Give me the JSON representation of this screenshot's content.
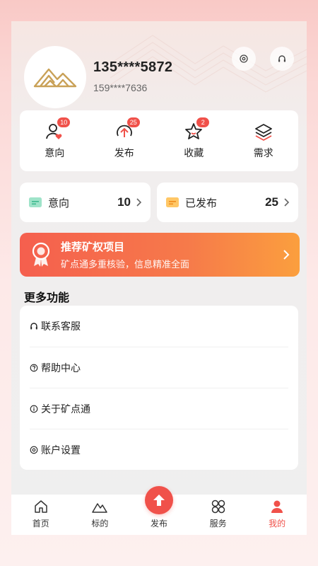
{
  "profile": {
    "name": "135****5872",
    "sub": "159****7636"
  },
  "stats": [
    {
      "label": "意向",
      "badge": "10",
      "icon": "user-heart-icon"
    },
    {
      "label": "发布",
      "badge": "25",
      "icon": "upload-circle-icon"
    },
    {
      "label": "收藏",
      "badge": "2",
      "icon": "star-icon"
    },
    {
      "label": "需求",
      "badge": "",
      "icon": "layers-icon"
    }
  ],
  "summary": {
    "intent": {
      "label": "意向",
      "count": "10"
    },
    "published": {
      "label": "已发布",
      "count": "25"
    }
  },
  "banner": {
    "title": "推荐矿权项目",
    "subtitle": "矿点通多重核验，信息精准全面"
  },
  "more": {
    "title": "更多功能",
    "items": [
      {
        "label": "联系客服",
        "icon": "headset-icon"
      },
      {
        "label": "帮助中心",
        "icon": "help-icon"
      },
      {
        "label": "关于矿点通",
        "icon": "info-icon"
      },
      {
        "label": "账户设置",
        "icon": "settings-icon"
      }
    ]
  },
  "tabs": [
    {
      "label": "首页",
      "icon": "home-icon"
    },
    {
      "label": "标的",
      "icon": "mountain-icon"
    },
    {
      "label": "发布",
      "icon": "publish-icon"
    },
    {
      "label": "服务",
      "icon": "grid-icon"
    },
    {
      "label": "我的",
      "icon": "user-icon"
    }
  ],
  "colors": {
    "accent": "#f0514a",
    "banner_start": "#f55f4e",
    "banner_end": "#fb9f3e",
    "gold": "#c9a157"
  }
}
